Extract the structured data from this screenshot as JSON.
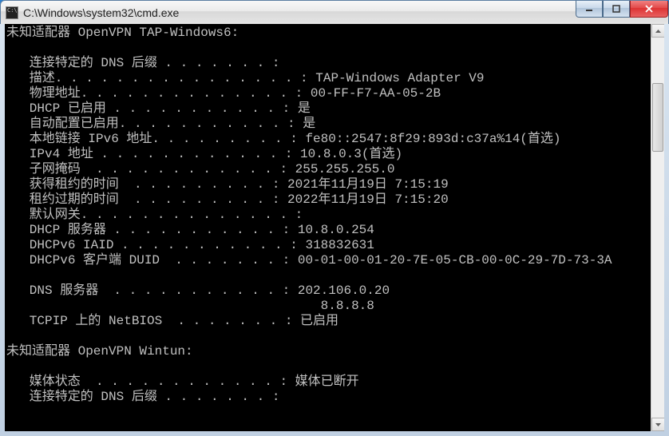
{
  "window": {
    "title": "C:\\Windows\\system32\\cmd.exe"
  },
  "adapters": [
    {
      "header": "未知适配器 OpenVPN TAP-Windows6:",
      "rows": [
        {
          "label": "连接特定的 DNS 后缀",
          "dots": " . . . . . . . ",
          "value": ""
        },
        {
          "label": "描述.",
          "dots": " . . . . . . . . . . . . . . . ",
          "value": "TAP-Windows Adapter V9"
        },
        {
          "label": "物理地址.",
          "dots": " . . . . . . . . . . . . . ",
          "value": "00-FF-F7-AA-05-2B"
        },
        {
          "label": "DHCP 已启用",
          "dots": " . . . . . . . . . . . ",
          "value": "是"
        },
        {
          "label": "自动配置已启用.",
          "dots": " . . . . . . . . . . ",
          "value": "是"
        },
        {
          "label": "本地链接 IPv6 地址.",
          "dots": " . . . . . . . . ",
          "value": "fe80::2547:8f29:893d:c37a%14(首选)"
        },
        {
          "label": "IPv4 地址",
          "dots": " . . . . . . . . . . . . ",
          "value": "10.8.0.3(首选)"
        },
        {
          "label": "子网掩码",
          "dots": "  . . . . . . . . . . . . ",
          "value": "255.255.255.0"
        },
        {
          "label": "获得租约的时间",
          "dots": "  . . . . . . . . . ",
          "value": "2021年11月19日 7:15:19"
        },
        {
          "label": "租约过期的时间",
          "dots": "  . . . . . . . . . ",
          "value": "2022年11月19日 7:15:20"
        },
        {
          "label": "默认网关.",
          "dots": " . . . . . . . . . . . . . ",
          "value": ""
        },
        {
          "label": "DHCP 服务器",
          "dots": " . . . . . . . . . . . ",
          "value": "10.8.0.254"
        },
        {
          "label": "DHCPv6 IAID",
          "dots": " . . . . . . . . . . . ",
          "value": "318832631"
        },
        {
          "label": "DHCPv6 客户端 DUID",
          "dots": "  . . . . . . . ",
          "value": "00-01-00-01-20-7E-05-CB-00-0C-29-7D-73-3A"
        },
        {
          "label": "",
          "dots": "",
          "value": ""
        },
        {
          "label": "DNS 服务器",
          "dots": "  . . . . . . . . . . . ",
          "value": "202.106.0.20"
        },
        {
          "label": "",
          "dots": "                                    ",
          "value": "8.8.8.8",
          "continuation": true
        },
        {
          "label": "TCPIP 上的 NetBIOS",
          "dots": "  . . . . . . . ",
          "value": "已启用"
        }
      ]
    },
    {
      "header": "未知适配器 OpenVPN Wintun:",
      "rows": [
        {
          "label": "媒体状态",
          "dots": "  . . . . . . . . . . . . ",
          "value": "媒体已断开"
        },
        {
          "label": "连接特定的 DNS 后缀",
          "dots": " . . . . . . . ",
          "value": ""
        }
      ]
    }
  ],
  "scrollbar": {
    "thumb_top_pct": 12,
    "thumb_height_pct": 18
  }
}
